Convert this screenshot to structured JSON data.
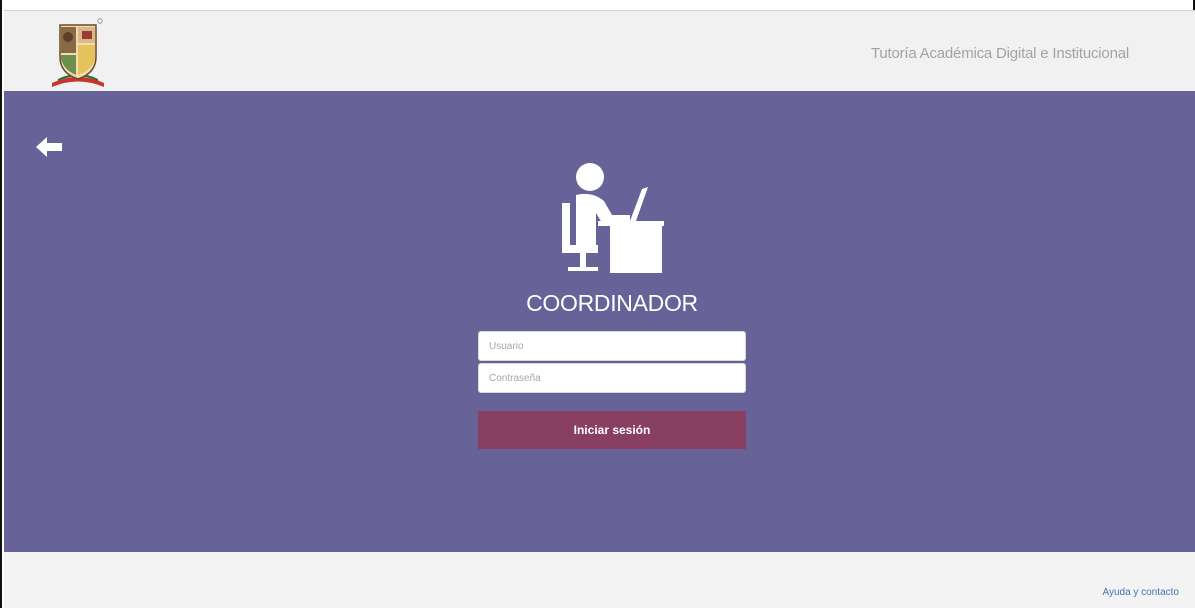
{
  "header": {
    "logo_icon": "institution-shield-logo-icon",
    "title": "Tutoría Académica Digital e Institucional"
  },
  "main": {
    "back_icon": "arrow-left-icon",
    "role_icon": "person-at-desk-computer-icon",
    "role_title": "COORDINADOR",
    "form": {
      "username_placeholder": "Usuario",
      "password_placeholder": "Contraseña",
      "submit_label": "Iniciar sesión"
    }
  },
  "footer": {
    "help_link": "Ayuda y contacto"
  },
  "colors": {
    "main_background": "#676398",
    "submit_button": "#883f62",
    "header_background": "#f1f1f1",
    "link": "#4672b8"
  }
}
